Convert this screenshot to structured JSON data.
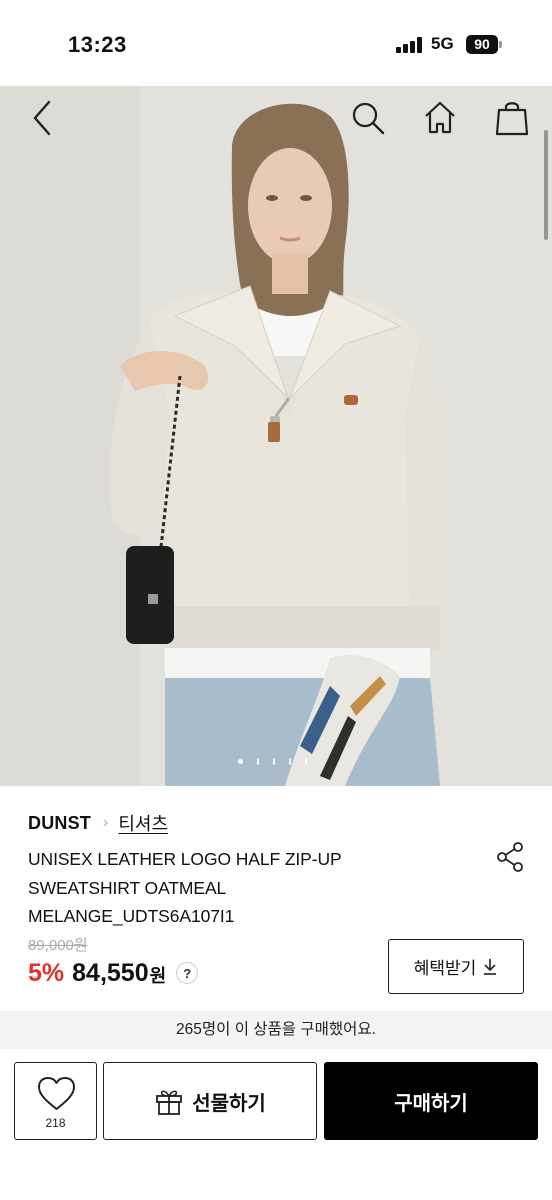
{
  "status_bar": {
    "time": "13:23",
    "network": "5G",
    "battery": "90"
  },
  "nav": {
    "back_icon": "chevron-left-icon",
    "search_icon": "search-icon",
    "home_icon": "home-icon",
    "cart_icon": "shopping-bag-icon"
  },
  "gallery": {
    "image_count": 5,
    "active_index": 0
  },
  "product": {
    "brand": "DUNST",
    "category": "티셔츠",
    "name": "UNISEX LEATHER LOGO HALF ZIP-UP SWEATSHIRT OATMEAL MELANGE_UDTS6A107I1",
    "original_price": "89,000원",
    "discount": "5%",
    "price": "84,550",
    "currency": "원",
    "help": "?",
    "benefit_label": "혜택받기",
    "benefit_icon": "download-arrow-icon",
    "share_icon": "share-icon"
  },
  "purchase_notice": "265명이 이 상품을 구매했어요.",
  "actions": {
    "like_icon": "heart-icon",
    "like_count": "218",
    "gift_icon": "gift-icon",
    "gift_label": "선물하기",
    "buy_label": "구매하기"
  },
  "colors": {
    "discount": "#e0322d",
    "buy_button": "#000000",
    "strip": "#f3f3f3"
  }
}
